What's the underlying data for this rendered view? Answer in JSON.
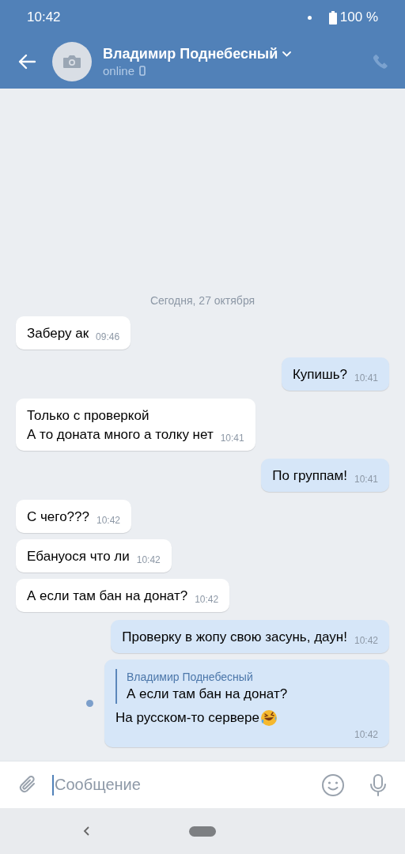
{
  "status_bar": {
    "time": "10:42",
    "battery": "100 %"
  },
  "header": {
    "name": "Владимир Поднебесный",
    "status": "online"
  },
  "date_separator": "Сегодня, 27 октября",
  "messages": [
    {
      "kind": "incoming",
      "text": "Заберу ак",
      "time": "09:46",
      "unread": false,
      "emoji": false
    },
    {
      "kind": "outgoing",
      "text": "Купишь?",
      "time": "10:41",
      "unread": false,
      "emoji": false
    },
    {
      "kind": "incoming",
      "text": "Только с проверкой\nА то доната много а толку нет",
      "time": "10:41",
      "unread": false,
      "emoji": false
    },
    {
      "kind": "outgoing",
      "text": "По группам!",
      "time": "10:41",
      "unread": false,
      "emoji": false
    },
    {
      "kind": "incoming",
      "text": "С чего???",
      "time": "10:42",
      "unread": false,
      "emoji": false
    },
    {
      "kind": "incoming",
      "text": "Ебануося что ли",
      "time": "10:42",
      "unread": false,
      "emoji": false
    },
    {
      "kind": "incoming",
      "text": "А если там бан на донат?",
      "time": "10:42",
      "unread": false,
      "emoji": false
    },
    {
      "kind": "outgoing",
      "text": "Проверку в жопу свою засунь, даун!",
      "time": "10:42",
      "unread": false,
      "emoji": false
    },
    {
      "kind": "outgoing",
      "text": "На русском-то сервере",
      "time": "10:42",
      "unread": true,
      "emoji": true,
      "reply": {
        "author": "Владимир Поднебесный",
        "text": "А если там бан на донат?"
      }
    }
  ],
  "composer": {
    "placeholder": "Сообщение"
  }
}
